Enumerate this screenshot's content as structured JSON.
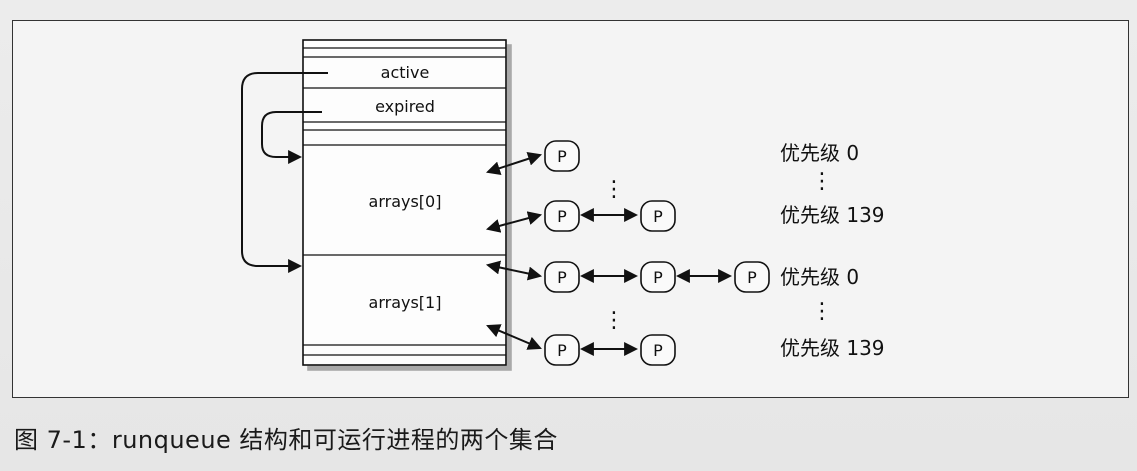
{
  "runqueue": {
    "fields": {
      "active": "active",
      "expired": "expired",
      "arrays0": "arrays[0]",
      "arrays1": "arrays[1]"
    }
  },
  "process_node_label": "P",
  "ellipsis": "⋮",
  "priorities": {
    "a0_top": "优先级 0",
    "a0_bottom": "优先级 139",
    "a1_top": "优先级 0",
    "a1_bottom": "优先级 139"
  },
  "caption": "图 7-1：runqueue 结构和可运行进程的两个集合"
}
